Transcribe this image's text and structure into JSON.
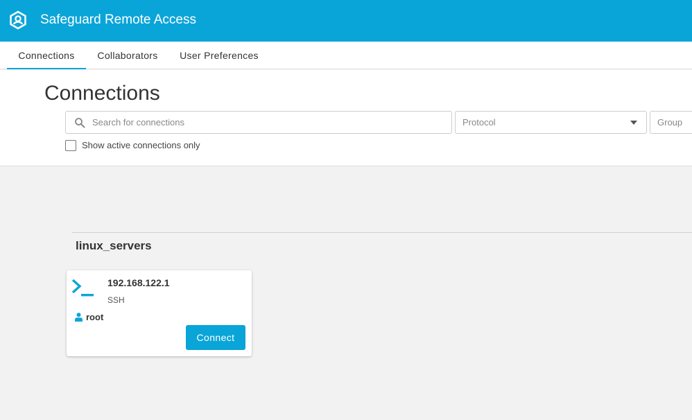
{
  "app": {
    "title": "Safeguard Remote Access",
    "logo_icon": "safeguard-logo-icon",
    "brand_color": "#0aa5d8"
  },
  "tabs": [
    {
      "label": "Connections",
      "active": true
    },
    {
      "label": "Collaborators",
      "active": false
    },
    {
      "label": "User Preferences",
      "active": false
    }
  ],
  "page": {
    "title": "Connections"
  },
  "filters": {
    "search_placeholder": "Search for connections",
    "search_value": "",
    "search_icon": "search-icon",
    "protocol_placeholder": "Protocol",
    "group_placeholder": "Group",
    "active_only_label": "Show active connections only",
    "active_only_checked": false
  },
  "groups": [
    {
      "name": "linux_servers",
      "connections": [
        {
          "host": "192.168.122.1",
          "protocol": "SSH",
          "icon": "terminal-icon",
          "user": "root",
          "user_icon": "user-icon",
          "connect_label": "Connect"
        }
      ]
    }
  ]
}
